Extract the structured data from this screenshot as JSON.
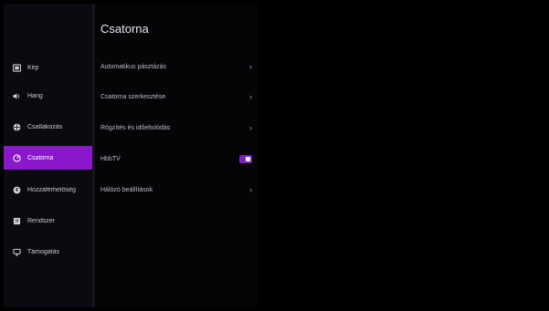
{
  "sidebar": {
    "items": [
      {
        "label": "Kép",
        "icon": "picture-icon",
        "active": false
      },
      {
        "label": "Hang",
        "icon": "speaker-icon",
        "active": false
      },
      {
        "label": "Csatlakozás",
        "icon": "globe-icon",
        "active": false
      },
      {
        "label": "Csatorna",
        "icon": "channel-icon",
        "active": true
      },
      {
        "label": "Hozzáférhetőség",
        "icon": "accessibility-icon",
        "active": false
      },
      {
        "label": "Rendszer",
        "icon": "system-icon",
        "active": false
      },
      {
        "label": "Támogatás",
        "icon": "support-icon",
        "active": false
      }
    ]
  },
  "panel": {
    "title": "Csatorna",
    "rows": [
      {
        "label": "Automatikus pásztázás",
        "control": "chevron"
      },
      {
        "label": "Csatorna szerkesztése",
        "control": "chevron"
      },
      {
        "label": "Rögzítés és időeltolódás",
        "control": "chevron"
      },
      {
        "label": "HbbTV",
        "control": "toggle",
        "value": true
      },
      {
        "label": "Hálózó beállítások",
        "control": "chevron"
      }
    ]
  },
  "colors": {
    "accent": "#8a17c9",
    "background": "#000000"
  }
}
